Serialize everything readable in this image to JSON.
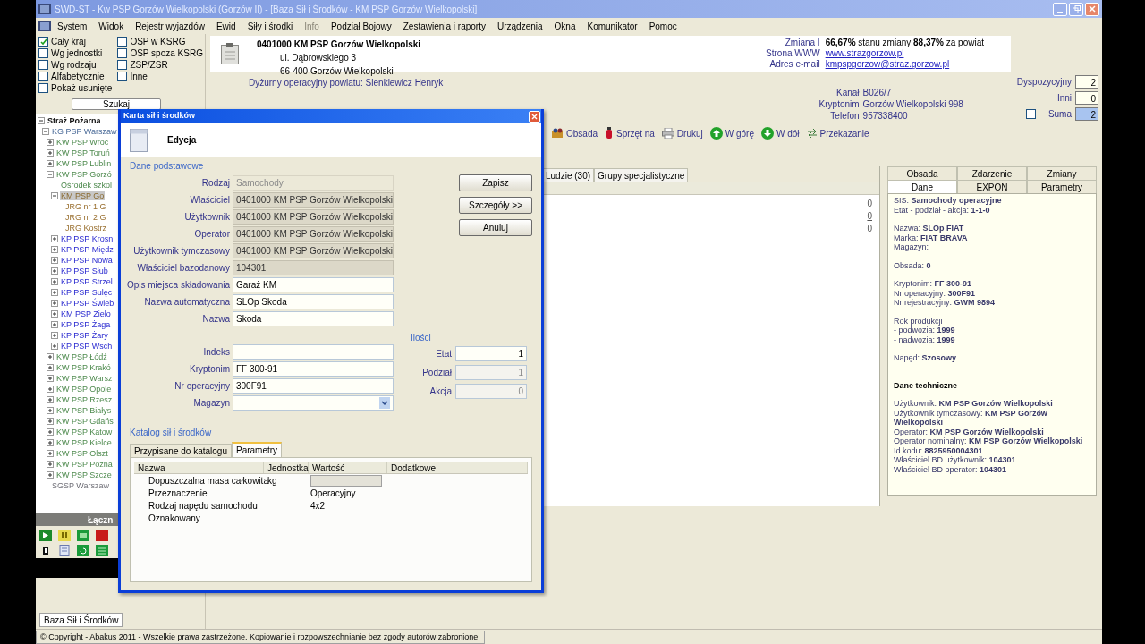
{
  "window": {
    "title": "SWD-ST - Kw PSP Gorzów Wielkopolski (Gorzów II) - [Baza Sił i Środków - KM PSP Gorzów Wielkopolski]"
  },
  "menu": [
    {
      "label": "System",
      "disabled": false
    },
    {
      "label": "Widok",
      "disabled": false
    },
    {
      "label": "Rejestr wyjazdów",
      "disabled": false
    },
    {
      "label": "Ewid",
      "disabled": false
    },
    {
      "label": "Siły i środki",
      "disabled": false
    },
    {
      "label": "Info",
      "disabled": true
    },
    {
      "label": "Podział Bojowy",
      "disabled": false
    },
    {
      "label": "Zestawienia i raporty",
      "disabled": false
    },
    {
      "label": "Urządzenia",
      "disabled": false
    },
    {
      "label": "Okna",
      "disabled": false
    },
    {
      "label": "Komunikator",
      "disabled": false
    },
    {
      "label": "Pomoc",
      "disabled": false
    }
  ],
  "filters_left": [
    {
      "label": "Cały kraj",
      "checked": true
    },
    {
      "label": "Wg jednostki",
      "checked": false
    },
    {
      "label": "Wg rodzaju",
      "checked": false
    },
    {
      "label": "Alfabetycznie",
      "checked": false
    },
    {
      "label": "Pokaż usunięte",
      "checked": false
    }
  ],
  "filters_right": [
    {
      "label": "OSP w KSRG",
      "checked": false
    },
    {
      "label": "OSP spoza KSRG",
      "checked": false
    },
    {
      "label": "ZSP/ZSR",
      "checked": false
    },
    {
      "label": "Inne",
      "checked": false
    }
  ],
  "search_button": "Szukaj",
  "tree": [
    {
      "label": "Straż Pożarna",
      "expanded": true,
      "selected": false,
      "kind": "root",
      "children": [
        {
          "label": "KG PSP Warszaw",
          "expanded": true,
          "selected": false,
          "kind": "hq",
          "children": [
            {
              "label": "KW PSP Wroc",
              "expanded": false,
              "selected": false,
              "kind": "province"
            },
            {
              "label": "KW PSP Toruń",
              "expanded": false,
              "selected": false,
              "kind": "province"
            },
            {
              "label": "KW PSP Lublin",
              "expanded": false,
              "selected": false,
              "kind": "province"
            },
            {
              "label": "KW PSP Gorzó",
              "expanded": true,
              "selected": false,
              "kind": "province",
              "children": [
                {
                  "label": "Ośrodek szkol",
                  "selected": false,
                  "kind": "province"
                },
                {
                  "label": "KM PSP Go",
                  "expanded": true,
                  "selected": true,
                  "kind": "city",
                  "children": [
                    {
                      "label": "JRG nr 1 G",
                      "selected": false,
                      "kind": "station"
                    },
                    {
                      "label": "JRG nr 2 G",
                      "selected": false,
                      "kind": "station"
                    },
                    {
                      "label": "JRG Kostrz",
                      "selected": false,
                      "kind": "station"
                    }
                  ]
                },
                {
                  "label": "KP PSP Krosn",
                  "expanded": false,
                  "selected": false,
                  "kind": "district"
                },
                {
                  "label": "KP PSP Międz",
                  "expanded": false,
                  "selected": false,
                  "kind": "district"
                },
                {
                  "label": "KP PSP Nowa",
                  "expanded": false,
                  "selected": false,
                  "kind": "district"
                },
                {
                  "label": "KP PSP Słub",
                  "expanded": false,
                  "selected": false,
                  "kind": "district"
                },
                {
                  "label": "KP PSP Strzel",
                  "expanded": false,
                  "selected": false,
                  "kind": "district"
                },
                {
                  "label": "KP PSP Sulęc",
                  "expanded": false,
                  "selected": false,
                  "kind": "district"
                },
                {
                  "label": "KP PSP Świeb",
                  "expanded": false,
                  "selected": false,
                  "kind": "district"
                },
                {
                  "label": "KM PSP Zielo",
                  "expanded": false,
                  "selected": false,
                  "kind": "district"
                },
                {
                  "label": "KP PSP Żaga",
                  "expanded": false,
                  "selected": false,
                  "kind": "district"
                },
                {
                  "label": "KP PSP Żary",
                  "expanded": false,
                  "selected": false,
                  "kind": "district"
                },
                {
                  "label": "KP PSP Wsch",
                  "expanded": false,
                  "selected": false,
                  "kind": "district"
                }
              ]
            },
            {
              "label": "KW PSP Łódź",
              "expanded": false,
              "selected": false,
              "kind": "province"
            },
            {
              "label": "KW PSP Krakó",
              "expanded": false,
              "selected": false,
              "kind": "province"
            },
            {
              "label": "KW PSP Warsz",
              "expanded": false,
              "selected": false,
              "kind": "province"
            },
            {
              "label": "KW PSP Opole",
              "expanded": false,
              "selected": false,
              "kind": "province"
            },
            {
              "label": "KW PSP Rzesz",
              "expanded": false,
              "selected": false,
              "kind": "province"
            },
            {
              "label": "KW PSP Białys",
              "expanded": false,
              "selected": false,
              "kind": "province"
            },
            {
              "label": "KW PSP Gdańs",
              "expanded": false,
              "selected": false,
              "kind": "province"
            },
            {
              "label": "KW PSP Katow",
              "expanded": false,
              "selected": false,
              "kind": "province"
            },
            {
              "label": "KW PSP Kielce",
              "expanded": false,
              "selected": false,
              "kind": "province"
            },
            {
              "label": "KW PSP Olszt",
              "expanded": false,
              "selected": false,
              "kind": "province"
            },
            {
              "label": "KW PSP Pozna",
              "expanded": false,
              "selected": false,
              "kind": "province"
            },
            {
              "label": "KW PSP Szcze",
              "expanded": false,
              "selected": false,
              "kind": "province"
            }
          ]
        },
        {
          "label": "SGSP Warszaw",
          "selected": false,
          "kind": "school"
        }
      ]
    }
  ],
  "side_section": "Łączn",
  "bottom_tab": "Baza Sił i Środków",
  "status_bar": "© Copyright - Abakus 2011 - Wszelkie prawa zastrzeżone. Kopiowanie i rozpowszechnianie bez zgody autorów zabronione.",
  "unit_card": {
    "name": "0401000 KM PSP Gorzów Wielkopolski",
    "street": "ul. Dąbrowskiego 3",
    "city": "66-400 Gorzów Wielkopolski",
    "shift_label": "Zmiana I",
    "shift_text": "**66,67%** stanu zmiany **88,37%** za powiat",
    "links": [
      {
        "label": "Strona WWW",
        "value": "www.strazgorzow.pl"
      },
      {
        "label": "Adres e-mail",
        "value": "kmpspgorzow@straz.gorzow.pl"
      }
    ]
  },
  "duty": "Dyżurny operacyjny powiatu: Sienkiewicz Henryk",
  "contact": [
    {
      "label": "Kanał",
      "value": "B026/7"
    },
    {
      "label": "Kryptonim",
      "value": "Gorzów Wielkopolski 998"
    },
    {
      "label": "Telefon",
      "value": "957338400"
    }
  ],
  "counters": [
    {
      "label": "Dyspozycyjny",
      "value": "2",
      "selected": false
    },
    {
      "label": "Inni",
      "value": "0",
      "selected": false
    },
    {
      "label": "Suma",
      "value": "2",
      "selected": true
    }
  ],
  "counters_checkbox": {
    "checked": false
  },
  "toolbar": [
    {
      "label": "Obsada",
      "kind": "people"
    },
    {
      "label": "Sprzęt na",
      "kind": "equipment"
    },
    {
      "label": "Drukuj",
      "kind": "print"
    },
    {
      "label": "W górę",
      "kind": "up"
    },
    {
      "label": "W dół",
      "kind": "down"
    },
    {
      "label": "Przekazanie",
      "kind": "transfer"
    }
  ],
  "list_tabs": [
    {
      "label": "Ludzie (30)",
      "selected": false
    },
    {
      "label": "Grupy specjalistyczne",
      "selected": false
    }
  ],
  "list_values": [
    "0",
    "0",
    "0"
  ],
  "detail_tab_rows": [
    [
      {
        "label": "Obsada",
        "selected": false
      },
      {
        "label": "Zdarzenie",
        "selected": false
      },
      {
        "label": "Zmiany",
        "selected": false
      }
    ],
    [
      {
        "label": "Dane",
        "selected": true
      },
      {
        "label": "EXPON",
        "selected": false
      },
      {
        "label": "Parametry",
        "selected": false
      }
    ]
  ],
  "details": [
    {
      "lines": [
        "SIS: **Samochody operacyjne**",
        "Etat - podział - akcja: **1-1-0**"
      ]
    },
    {
      "lines": [
        "Nazwa: **SLOp FIAT**",
        "Marka: **FIAT BRAVA**",
        "Magazyn:"
      ]
    },
    {
      "lines": [
        "Obsada: **0**"
      ]
    },
    {
      "lines": [
        "Kryptonim: **FF 300-91**",
        "Nr operacyjny: **300F91**",
        "Nr rejestracyjny: **GWM 9894**"
      ]
    },
    {
      "lines": [
        "Rok produkcji",
        "- podwozia: **1999**",
        "- nadwozia: **1999**"
      ]
    },
    {
      "lines": [
        "Napęd: **Szosowy**"
      ]
    },
    {
      "heading": "Dane techniczne",
      "lines": [
        "Użytkownik: **KM PSP Gorzów Wielkopolski**",
        "Użytkownik tymczasowy: **KM PSP Gorzów Wielkopolski**",
        "Operator: **KM PSP Gorzów Wielkopolski**",
        "Operator nominalny: **KM PSP Gorzów Wielkopolski**",
        "Id kodu: **8825950004301**",
        "Właściciel BD użytkownik: **104301**",
        "Właściciel BD operator: **104301**"
      ]
    }
  ],
  "dialog": {
    "title": "Karta sił i środków",
    "header": "Edycja",
    "group_basic": "Dane podstawowe",
    "fields": [
      {
        "label": "Rodzaj",
        "value": "Samochody",
        "kind": "disabled"
      },
      {
        "label": "Właściciel",
        "value": "0401000 KM PSP Gorzów Wielkopolski",
        "kind": "readonly"
      },
      {
        "label": "Użytkownik",
        "value": "0401000 KM PSP Gorzów Wielkopolski",
        "kind": "readonly"
      },
      {
        "label": "Operator",
        "value": "0401000 KM PSP Gorzów Wielkopolski",
        "kind": "readonly"
      },
      {
        "label": "Użytkownik tymczasowy",
        "value": "0401000 KM PSP Gorzów Wielkopolski",
        "kind": "readonly"
      },
      {
        "label": "Właściciel bazodanowy",
        "value": "104301",
        "kind": "readonly"
      },
      {
        "label": "Opis miejsca składowania",
        "value": "Garaż KM",
        "kind": "text"
      },
      {
        "label": "Nazwa automatyczna",
        "value": "SLOp Skoda",
        "kind": "text"
      },
      {
        "label": "Nazwa",
        "value": "Skoda",
        "kind": "text"
      }
    ],
    "fields_2": [
      {
        "label": "Indeks",
        "kind": "text"
      },
      {
        "label": "Kryptonim",
        "value": "FF 300-91",
        "kind": "text"
      },
      {
        "label": "Nr operacyjny",
        "value": "300F91",
        "kind": "text"
      },
      {
        "label": "Magazyn",
        "kind": "dropdown"
      }
    ],
    "buttons": [
      "Zapisz",
      "Szczegóły >>",
      "Anuluj"
    ],
    "quantities": {
      "title": "Ilości",
      "rows": [
        {
          "label": "Etat",
          "value": "1",
          "disabled": false
        },
        {
          "label": "Podział",
          "value": "1",
          "disabled": true
        },
        {
          "label": "Akcja",
          "value": "0",
          "disabled": true
        }
      ]
    },
    "catalog": {
      "title": "Katalog sił i środków",
      "tabs": [
        {
          "label": "Przypisane do katalogu",
          "selected": false
        },
        {
          "label": "Parametry",
          "selected": true
        }
      ],
      "columns": [
        "Nazwa",
        "Jednostka",
        "Wartość",
        "Dodatkowe"
      ],
      "rows": [
        {
          "name": "Dopuszczalna masa całkowita",
          "unit": "kg",
          "editing": true
        },
        {
          "name": "Przeznaczenie",
          "value": "Operacyjny",
          "editing": false
        },
        {
          "name": "Rodzaj napędu samochodu",
          "value": "4x2",
          "editing": false
        },
        {
          "name": "Oznakowany",
          "editing": false
        }
      ]
    }
  }
}
